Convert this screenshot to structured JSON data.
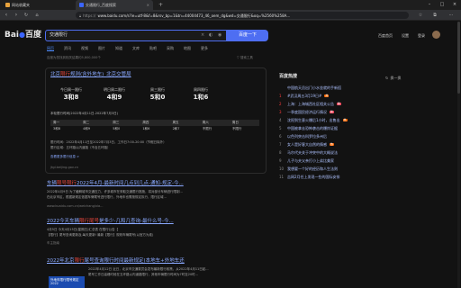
{
  "browser": {
    "tabs": [
      {
        "label": "网站收藏夹",
        "active": false
      },
      {
        "label": "交通限行_百度搜索",
        "active": true
      }
    ],
    "url_prefix": "https://",
    "url": "www.baidu.com/s?ie=utf-8&f=8&rsv_bp=1&tn=44004473_46_oem_dg&wd=交通限行&oq=%2560%258A…"
  },
  "header": {
    "logo_text": "Bai",
    "logo_cn": "百度",
    "query": "交通限行",
    "search_button": "百度一下",
    "links": [
      "百度首页",
      "设置",
      "登录"
    ]
  },
  "tabs": [
    "网页",
    "资讯",
    "视频",
    "图片",
    "知道",
    "文库",
    "贴吧",
    "采购",
    "地图",
    "更多"
  ],
  "result_count": "百度为您找到相关结果约5,800,000个",
  "search_tools": "搜索工具",
  "card": {
    "title_pre": "北京",
    "title_hl": "限行",
    "title_post": "规则(含外地车)_北京交管局",
    "cells": [
      {
        "label": "今日周一限行",
        "value": "3和8"
      },
      {
        "label": "明日周二限行",
        "value": "4和9"
      },
      {
        "label": "周三限行",
        "value": "5和0"
      },
      {
        "label": "周四限行",
        "value": "1和6"
      }
    ],
    "period": "本轮限行时间(2022年4月11日-2022年7月3日)",
    "table_header": [
      "周一",
      "周二",
      "周三",
      "周四",
      "周五",
      "周六",
      "周日"
    ],
    "table_row": [
      "3和8",
      "4和9",
      "5和0",
      "1和6",
      "2和7",
      "不限行",
      "不限行"
    ],
    "notes": [
      "限行时间：2022年4月11日至2022年7月3日，工作日7:00-20:00（节假日除外）",
      "限行区域：五环路以内道路（不含五环路）"
    ],
    "more": "查看更多限行信息 >",
    "source": "jtgl.beijing.gov.cn"
  },
  "results": [
    {
      "title_pre": "车辆",
      "title_hl": "限号限行",
      "title_post": "2022年4月-最新时间几点到几点-通知-规定-今...",
      "snippet1": "2022年4月9日 为了缓解城市交通压力，许多城市在采取交通限行措施，将对部分车辆进行限制...",
      "snippet2": "在北京市区，根据新规定依据车牌尾号进行限行，外地车也需按规定执行，限行区域...",
      "source": "www.kuaidu.com.cn/weichang/xia..."
    },
    {
      "title_pre": "2022今天车辆",
      "title_hl": "限行尾号",
      "title_post": "是多少-几和几查询-最什么号-今...",
      "snippet1": "4月5日 今天4月15日(星期五)汇总表 在限行公告【",
      "snippet2": "【限行】尾号查询更新及,每天更新! 最新【限行】规则车辆尾号(以官方为准)",
      "source": "车主指南"
    },
    {
      "title_pre": "2022年北京",
      "title_hl": "限行",
      "title_post": "尾号查询限行时间最新规定(本地车+外地车还",
      "snippet1": "2022年4月12日 近日，北京市交通委员会发布最新限行政策，从2022年4月11日起...",
      "snippet2": "尾号工作日高峰时段在五环路以内道路限行，其他车辆限行时间为7时至20时..."
    }
  ],
  "thumb_label": "外地车限行限号规定2022",
  "hot": {
    "title": "百度热搜",
    "refresh": "换一换",
    "items": [
      {
        "rank": "",
        "text": "中国航天员出门小水坐就的手新搭",
        "badge": ""
      },
      {
        "rank": "1",
        "text": "#武汉周五3月19日#",
        "badge": "热"
      },
      {
        "rank": "2",
        "text": "上海：上海城西社区相关公告",
        "badge": "新"
      },
      {
        "rank": "3",
        "text": "一季度国民经济运行情况",
        "badge": "新"
      },
      {
        "rank": "4",
        "text": "沈阳到生意火爆后1小时，出售出",
        "badge": "热"
      },
      {
        "rank": "5",
        "text": "中国被拿去恐怖袭击的爆炸证据",
        "badge": ""
      },
      {
        "rank": "6",
        "text": "以色列突击科罗拉多州后",
        "badge": ""
      },
      {
        "rank": "7",
        "text": "女人是好客大自然的情感",
        "badge": "热"
      },
      {
        "rank": "8",
        "text": "马尔代夫关于冲突中的大概说法",
        "badge": ""
      },
      {
        "rank": "9",
        "text": "儿子与夫父亲打小上弟比美家",
        "badge": ""
      },
      {
        "rank": "10",
        "text": "我想要一个好的经历和人生法则",
        "badge": ""
      },
      {
        "rank": "11",
        "text": "吉网2月任上发现一些的国际安排",
        "badge": ""
      }
    ]
  }
}
